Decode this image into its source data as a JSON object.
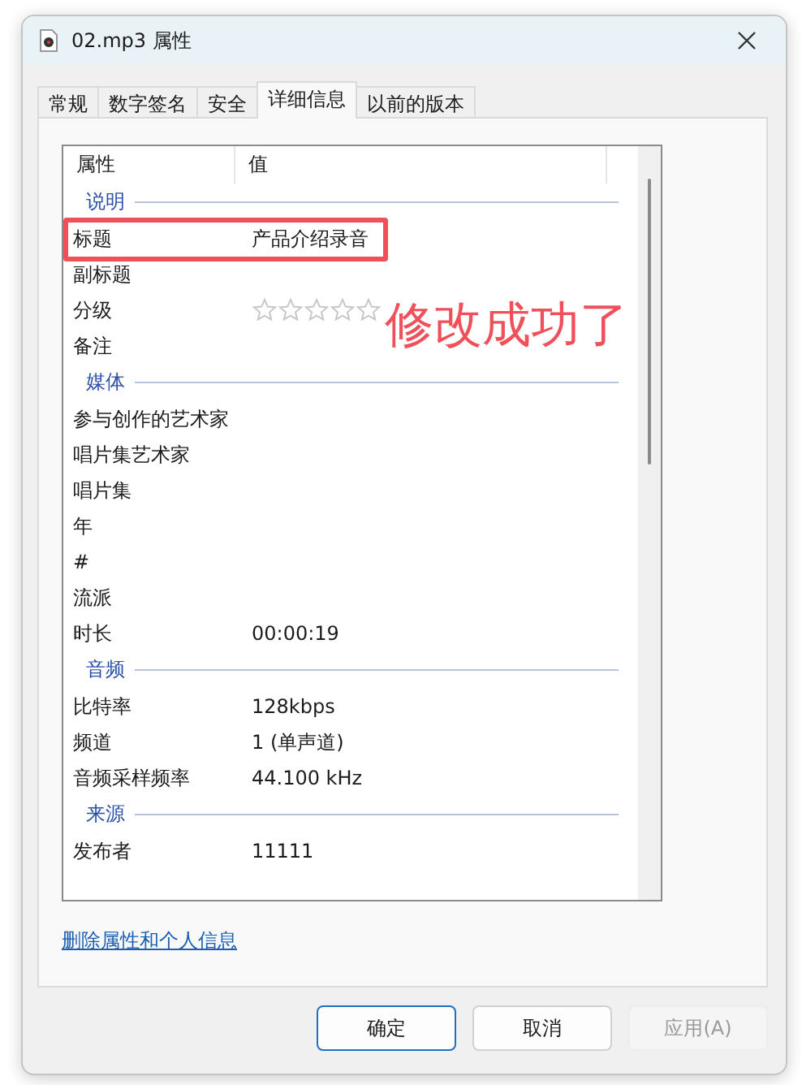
{
  "window": {
    "title": "02.mp3 属性"
  },
  "tabs": [
    {
      "label": "常规",
      "selected": false
    },
    {
      "label": "数字签名",
      "selected": false
    },
    {
      "label": "安全",
      "selected": false
    },
    {
      "label": "详细信息",
      "selected": true
    },
    {
      "label": "以前的版本",
      "selected": false
    }
  ],
  "table": {
    "columns": [
      "属性",
      "值"
    ],
    "rows": [
      {
        "kind": "group",
        "name": "说明"
      },
      {
        "kind": "property",
        "name": "标题",
        "value": "产品介绍录音",
        "highlighted": true
      },
      {
        "kind": "property",
        "name": "副标题",
        "highlighted": false
      },
      {
        "kind": "rating",
        "name": "分级",
        "stars": 0
      },
      {
        "kind": "property",
        "name": "备注",
        "highlighted": false
      },
      {
        "kind": "group",
        "name": "媒体"
      },
      {
        "kind": "property",
        "name": "参与创作的艺术家",
        "highlighted": false
      },
      {
        "kind": "property",
        "name": "唱片集艺术家",
        "highlighted": false
      },
      {
        "kind": "property",
        "name": "唱片集",
        "highlighted": false
      },
      {
        "kind": "property",
        "name": "年",
        "highlighted": false
      },
      {
        "kind": "property",
        "name": "#",
        "highlighted": false
      },
      {
        "kind": "property",
        "name": "流派",
        "highlighted": false
      },
      {
        "kind": "property",
        "name": "时长",
        "value": "00:00:19",
        "highlighted": false
      },
      {
        "kind": "group",
        "name": "音频"
      },
      {
        "kind": "property",
        "name": "比特率",
        "value": "128kbps",
        "highlighted": false
      },
      {
        "kind": "property",
        "name": "频道",
        "value": "1 (单声道)",
        "highlighted": false
      },
      {
        "kind": "property",
        "name": "音频采样频率",
        "value": "44.100 kHz",
        "highlighted": false
      },
      {
        "kind": "group",
        "name": "来源"
      },
      {
        "kind": "property",
        "name": "发布者",
        "value": "11111",
        "highlighted": false
      }
    ]
  },
  "annotation": {
    "text": "修改成功了"
  },
  "link": "删除属性和个人信息",
  "buttons": [
    {
      "label": "确定",
      "default": true,
      "disabled": false
    },
    {
      "label": "取消",
      "default": false,
      "disabled": false
    },
    {
      "label": "应用(A)",
      "default": false,
      "disabled": true
    }
  ]
}
